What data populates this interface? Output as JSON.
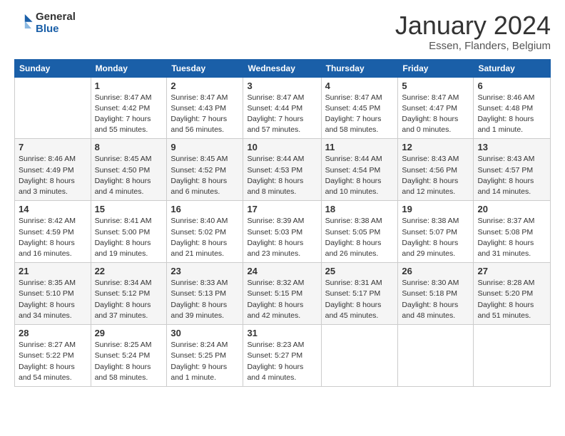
{
  "logo": {
    "general": "General",
    "blue": "Blue"
  },
  "header": {
    "month": "January 2024",
    "location": "Essen, Flanders, Belgium"
  },
  "weekdays": [
    "Sunday",
    "Monday",
    "Tuesday",
    "Wednesday",
    "Thursday",
    "Friday",
    "Saturday"
  ],
  "weeks": [
    [
      {
        "day": "",
        "info": ""
      },
      {
        "day": "1",
        "info": "Sunrise: 8:47 AM\nSunset: 4:42 PM\nDaylight: 7 hours\nand 55 minutes."
      },
      {
        "day": "2",
        "info": "Sunrise: 8:47 AM\nSunset: 4:43 PM\nDaylight: 7 hours\nand 56 minutes."
      },
      {
        "day": "3",
        "info": "Sunrise: 8:47 AM\nSunset: 4:44 PM\nDaylight: 7 hours\nand 57 minutes."
      },
      {
        "day": "4",
        "info": "Sunrise: 8:47 AM\nSunset: 4:45 PM\nDaylight: 7 hours\nand 58 minutes."
      },
      {
        "day": "5",
        "info": "Sunrise: 8:47 AM\nSunset: 4:47 PM\nDaylight: 8 hours\nand 0 minutes."
      },
      {
        "day": "6",
        "info": "Sunrise: 8:46 AM\nSunset: 4:48 PM\nDaylight: 8 hours\nand 1 minute."
      }
    ],
    [
      {
        "day": "7",
        "info": "Sunrise: 8:46 AM\nSunset: 4:49 PM\nDaylight: 8 hours\nand 3 minutes."
      },
      {
        "day": "8",
        "info": "Sunrise: 8:45 AM\nSunset: 4:50 PM\nDaylight: 8 hours\nand 4 minutes."
      },
      {
        "day": "9",
        "info": "Sunrise: 8:45 AM\nSunset: 4:52 PM\nDaylight: 8 hours\nand 6 minutes."
      },
      {
        "day": "10",
        "info": "Sunrise: 8:44 AM\nSunset: 4:53 PM\nDaylight: 8 hours\nand 8 minutes."
      },
      {
        "day": "11",
        "info": "Sunrise: 8:44 AM\nSunset: 4:54 PM\nDaylight: 8 hours\nand 10 minutes."
      },
      {
        "day": "12",
        "info": "Sunrise: 8:43 AM\nSunset: 4:56 PM\nDaylight: 8 hours\nand 12 minutes."
      },
      {
        "day": "13",
        "info": "Sunrise: 8:43 AM\nSunset: 4:57 PM\nDaylight: 8 hours\nand 14 minutes."
      }
    ],
    [
      {
        "day": "14",
        "info": "Sunrise: 8:42 AM\nSunset: 4:59 PM\nDaylight: 8 hours\nand 16 minutes."
      },
      {
        "day": "15",
        "info": "Sunrise: 8:41 AM\nSunset: 5:00 PM\nDaylight: 8 hours\nand 19 minutes."
      },
      {
        "day": "16",
        "info": "Sunrise: 8:40 AM\nSunset: 5:02 PM\nDaylight: 8 hours\nand 21 minutes."
      },
      {
        "day": "17",
        "info": "Sunrise: 8:39 AM\nSunset: 5:03 PM\nDaylight: 8 hours\nand 23 minutes."
      },
      {
        "day": "18",
        "info": "Sunrise: 8:38 AM\nSunset: 5:05 PM\nDaylight: 8 hours\nand 26 minutes."
      },
      {
        "day": "19",
        "info": "Sunrise: 8:38 AM\nSunset: 5:07 PM\nDaylight: 8 hours\nand 29 minutes."
      },
      {
        "day": "20",
        "info": "Sunrise: 8:37 AM\nSunset: 5:08 PM\nDaylight: 8 hours\nand 31 minutes."
      }
    ],
    [
      {
        "day": "21",
        "info": "Sunrise: 8:35 AM\nSunset: 5:10 PM\nDaylight: 8 hours\nand 34 minutes."
      },
      {
        "day": "22",
        "info": "Sunrise: 8:34 AM\nSunset: 5:12 PM\nDaylight: 8 hours\nand 37 minutes."
      },
      {
        "day": "23",
        "info": "Sunrise: 8:33 AM\nSunset: 5:13 PM\nDaylight: 8 hours\nand 39 minutes."
      },
      {
        "day": "24",
        "info": "Sunrise: 8:32 AM\nSunset: 5:15 PM\nDaylight: 8 hours\nand 42 minutes."
      },
      {
        "day": "25",
        "info": "Sunrise: 8:31 AM\nSunset: 5:17 PM\nDaylight: 8 hours\nand 45 minutes."
      },
      {
        "day": "26",
        "info": "Sunrise: 8:30 AM\nSunset: 5:18 PM\nDaylight: 8 hours\nand 48 minutes."
      },
      {
        "day": "27",
        "info": "Sunrise: 8:28 AM\nSunset: 5:20 PM\nDaylight: 8 hours\nand 51 minutes."
      }
    ],
    [
      {
        "day": "28",
        "info": "Sunrise: 8:27 AM\nSunset: 5:22 PM\nDaylight: 8 hours\nand 54 minutes."
      },
      {
        "day": "29",
        "info": "Sunrise: 8:25 AM\nSunset: 5:24 PM\nDaylight: 8 hours\nand 58 minutes."
      },
      {
        "day": "30",
        "info": "Sunrise: 8:24 AM\nSunset: 5:25 PM\nDaylight: 9 hours\nand 1 minute."
      },
      {
        "day": "31",
        "info": "Sunrise: 8:23 AM\nSunset: 5:27 PM\nDaylight: 9 hours\nand 4 minutes."
      },
      {
        "day": "",
        "info": ""
      },
      {
        "day": "",
        "info": ""
      },
      {
        "day": "",
        "info": ""
      }
    ]
  ]
}
